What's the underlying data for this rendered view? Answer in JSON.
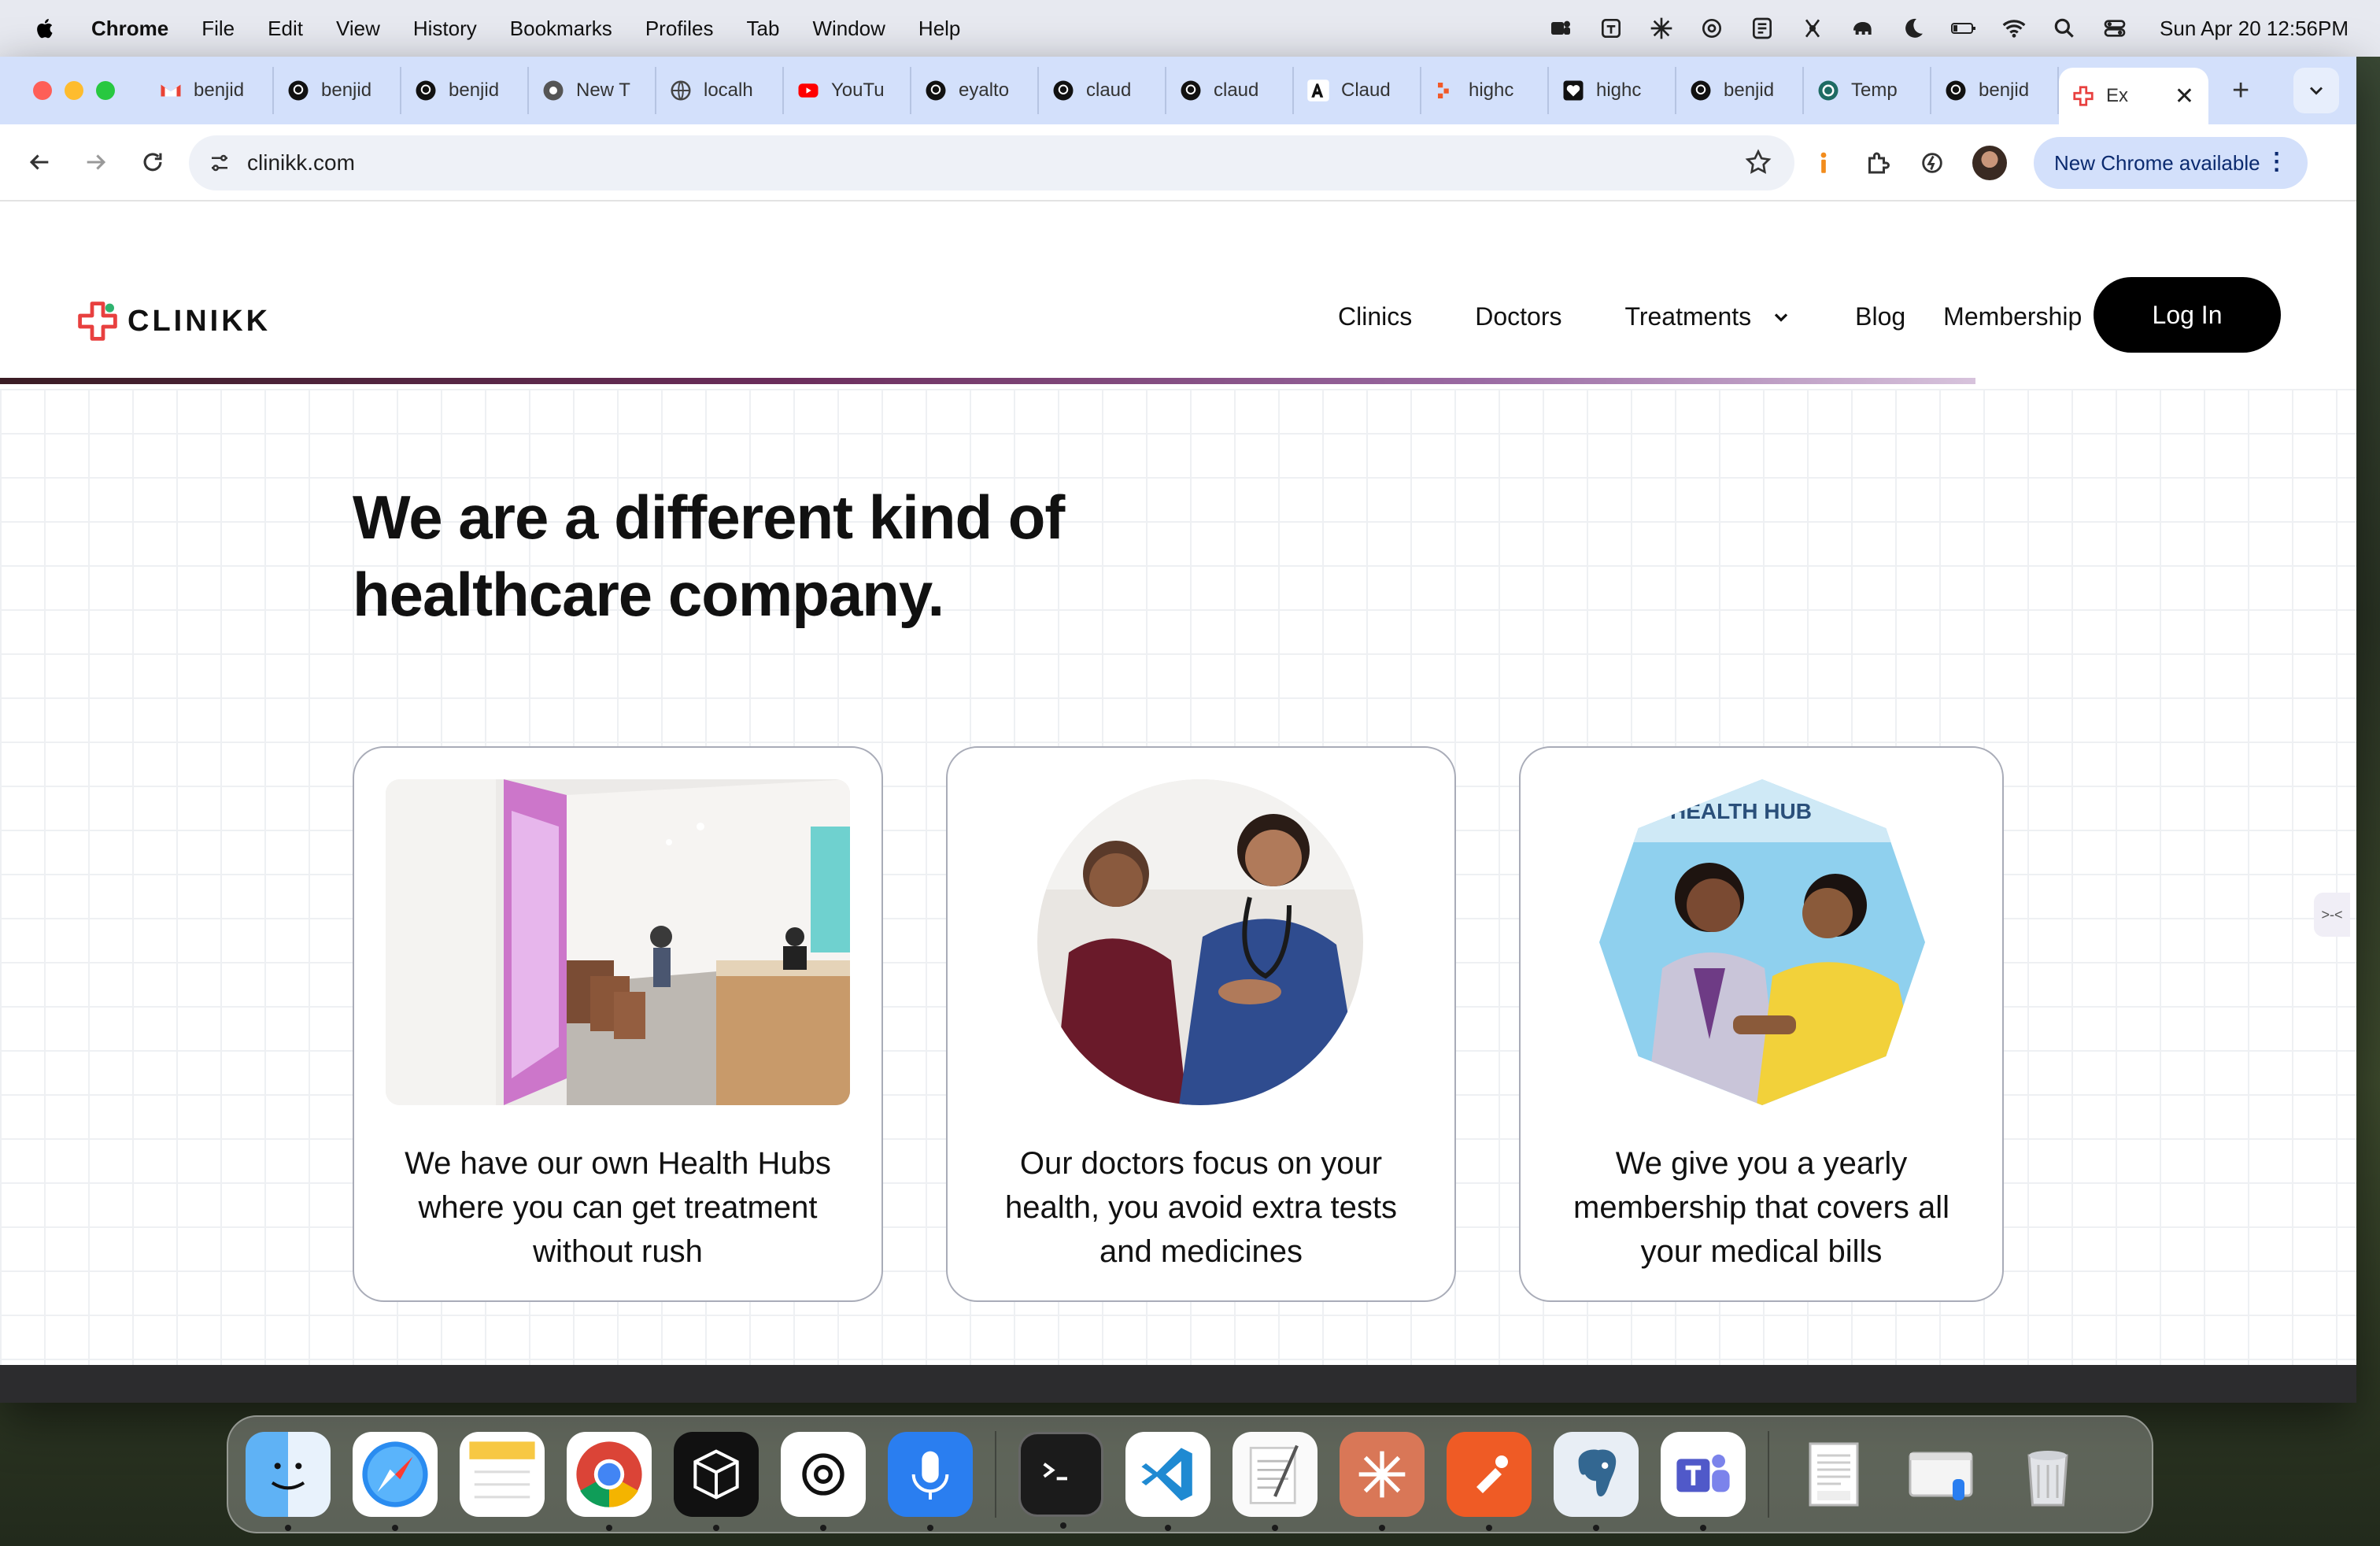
{
  "menubar": {
    "app_name": "Chrome",
    "items": [
      "File",
      "Edit",
      "View",
      "History",
      "Bookmarks",
      "Profiles",
      "Tab",
      "Window",
      "Help"
    ],
    "clock": "Sun Apr 20  12:56PM"
  },
  "tabs": [
    {
      "label": "benjid",
      "icon": "gmail-icon"
    },
    {
      "label": "benjid",
      "icon": "github-icon"
    },
    {
      "label": "benjid",
      "icon": "github-icon"
    },
    {
      "label": "New T",
      "icon": "chrome-icon"
    },
    {
      "label": "localh",
      "icon": "globe-icon"
    },
    {
      "label": "YouTu",
      "icon": "youtube-icon"
    },
    {
      "label": "eyalto",
      "icon": "github-icon"
    },
    {
      "label": "claud",
      "icon": "github-icon"
    },
    {
      "label": "claud",
      "icon": "github-icon"
    },
    {
      "label": "Claud",
      "icon": "anthropic-icon"
    },
    {
      "label": "highc",
      "icon": "highcharts-icon"
    },
    {
      "label": "highc",
      "icon": "heart-icon"
    },
    {
      "label": "benjid",
      "icon": "github-icon"
    },
    {
      "label": "Temp",
      "icon": "template-icon"
    },
    {
      "label": "benjid",
      "icon": "github-icon"
    }
  ],
  "active_tab": {
    "label": "Ex",
    "icon": "clinikk-icon"
  },
  "toolbar": {
    "url": "clinikk.com",
    "update_label": "New Chrome available"
  },
  "site": {
    "logo_text": "CLINIKK",
    "nav": {
      "clinics": "Clinics",
      "doctors": "Doctors",
      "treatments": "Treatments",
      "blog": "Blog",
      "membership": "Membership"
    },
    "login_label": "Log In",
    "headline_line1": "We are a different kind of",
    "headline_line2": "healthcare company.",
    "cards": [
      {
        "caption": "We have our own Health Hubs where you can get treatment without rush"
      },
      {
        "caption": "Our doctors focus on your health, you avoid extra tests and medicines"
      },
      {
        "caption": "We give you a yearly membership that covers all your medical bills"
      }
    ],
    "card3_sign_text": "HEALTH HUB"
  },
  "colors": {
    "brand_accent": "#e8403f",
    "tab_strip": "#d3e0fb",
    "login_button": "#000000"
  }
}
